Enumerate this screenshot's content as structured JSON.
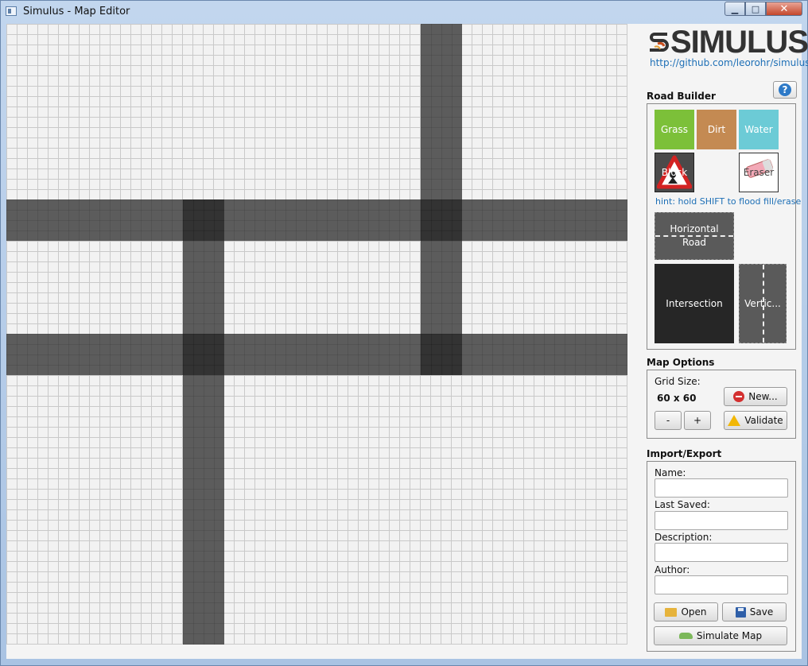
{
  "window": {
    "title": "Simulus - Map Editor",
    "min": "▁",
    "max": "□",
    "close": "✕"
  },
  "logo": {
    "text": "SIMULUS",
    "link": "http://github.com/leorohr/simulus"
  },
  "road_builder": {
    "title": "Road Builder",
    "help": "?",
    "tiles": {
      "grass": "Grass",
      "dirt": "Dirt",
      "water": "Water",
      "block": "Block",
      "eraser": "Eraser"
    },
    "hint": "hint: hold SHIFT to flood fill/erase",
    "horizontal_road": "Horizontal Road",
    "intersection": "Intersection",
    "vertical_road": "Vertic..."
  },
  "map_options": {
    "title": "Map Options",
    "grid_size_label": "Grid Size:",
    "grid_size_value": "60 x 60",
    "decrease": "-",
    "increase": "+",
    "new": "New...",
    "validate": "Validate"
  },
  "import_export": {
    "title": "Import/Export",
    "name_label": "Name:",
    "name_value": "",
    "last_saved_label": "Last Saved:",
    "last_saved_value": "",
    "description_label": "Description:",
    "description_value": "",
    "author_label": "Author:",
    "author_value": "",
    "open": "Open",
    "save": "Save",
    "simulate": "Simulate Map"
  },
  "colors": {
    "road": "#5c5c5c",
    "intersection": "#333333",
    "grass": "#7cc039",
    "dirt": "#c48a52",
    "water": "#6ccbd6",
    "link": "#1d6fb6"
  }
}
